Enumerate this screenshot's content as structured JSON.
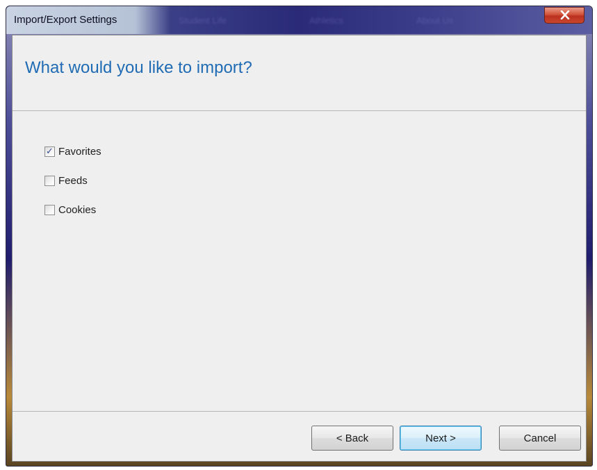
{
  "window": {
    "title": "Import/Export Settings",
    "background_ghost_tabs": [
      "Student Life",
      "Athletics",
      "About Us"
    ]
  },
  "header": {
    "heading": "What would you like to import?"
  },
  "options": [
    {
      "label": "Favorites",
      "checked": true
    },
    {
      "label": "Feeds",
      "checked": false
    },
    {
      "label": "Cookies",
      "checked": false
    }
  ],
  "buttons": {
    "back": "< Back",
    "next": "Next >",
    "cancel": "Cancel"
  },
  "colors": {
    "heading": "#1f6bb4",
    "close_button": "#c9472d",
    "default_button_border": "#3c7fb1"
  }
}
